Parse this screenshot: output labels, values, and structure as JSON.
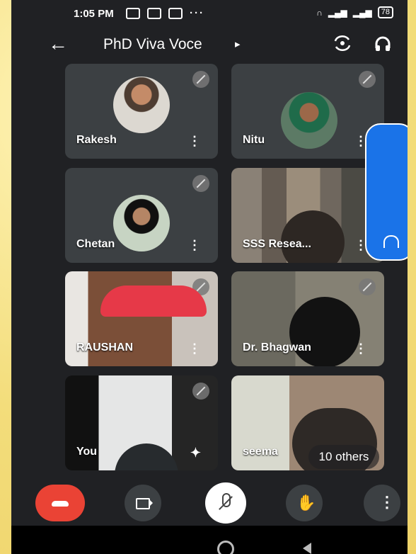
{
  "status": {
    "time": "1:05 PM",
    "battery": "78"
  },
  "header": {
    "title": "PhD Viva Voce",
    "back_icon": "arrow-left-icon",
    "flip_icon": "camera-flip-icon",
    "audio_icon": "headphones-icon"
  },
  "participants": [
    {
      "name": "Rakesh"
    },
    {
      "name": "Nitu"
    },
    {
      "name": "Chetan"
    },
    {
      "name": "SSS Resea..."
    },
    {
      "name": "RAUSHAN"
    },
    {
      "name": "Dr. Bhagwan"
    },
    {
      "name": "You"
    },
    {
      "name": "seema"
    }
  ],
  "others_label": "10 others",
  "controls": {
    "end_call_icon": "end-call-icon",
    "camera_icon": "video-camera-icon",
    "mic_icon": "mic-off-icon",
    "hand_icon": "hand-raise-icon",
    "more_icon": "more-vert-icon"
  }
}
